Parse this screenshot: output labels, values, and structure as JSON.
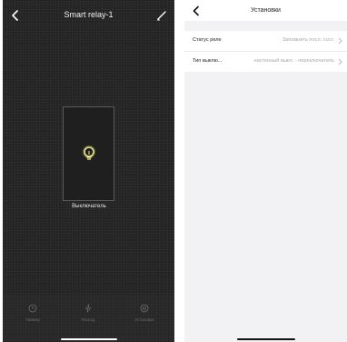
{
  "relay_screen": {
    "title": "Smart relay-1",
    "switch_label": "Выключатель",
    "tabs": [
      {
        "label": "Таймер",
        "icon": "clock-icon"
      },
      {
        "label": "Расход",
        "icon": "bolt-icon"
      },
      {
        "label": "Установки",
        "icon": "gear-icon"
      }
    ]
  },
  "settings_screen": {
    "title": "Установки",
    "rows": [
      {
        "label": "Статус реле",
        "value": "Запомнить посл. сост."
      },
      {
        "label": "Тип выклю...",
        "value": "настенный выкл. - переключатель"
      }
    ]
  },
  "colors": {
    "relay_background": "#262626",
    "bulb_glow": "#f5f08a",
    "settings_background": "#f2f2f4"
  }
}
